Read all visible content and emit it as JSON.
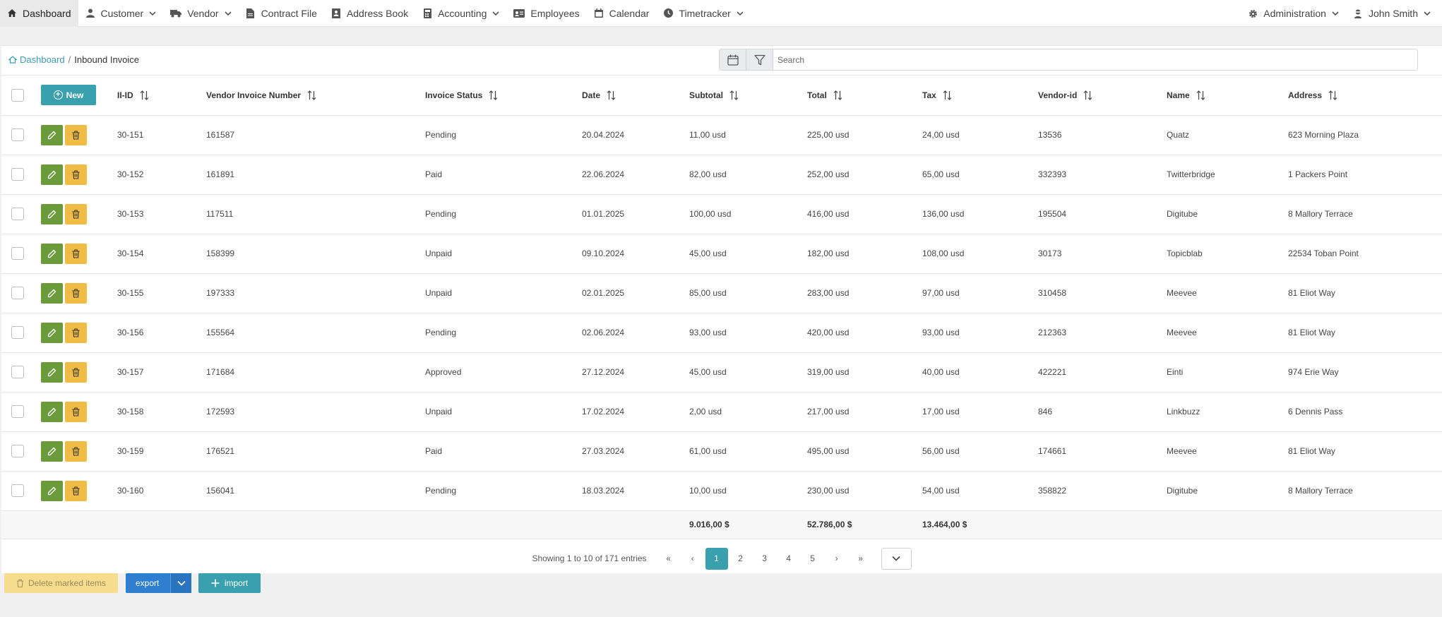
{
  "nav": {
    "items": [
      {
        "label": "Dashboard",
        "icon": "home-icon"
      },
      {
        "label": "Customer",
        "icon": "user-icon"
      },
      {
        "label": "Vendor",
        "icon": "truck-icon"
      },
      {
        "label": "Contract File",
        "icon": "file-icon"
      },
      {
        "label": "Address Book",
        "icon": "address-book-icon"
      },
      {
        "label": "Accounting",
        "icon": "calculator-icon"
      },
      {
        "label": "Employees",
        "icon": "id-card-icon"
      },
      {
        "label": "Calendar",
        "icon": "calendar-icon"
      },
      {
        "label": "Timetracker",
        "icon": "clock-icon"
      }
    ],
    "admin_label": "Administration",
    "user_label": "John Smith"
  },
  "breadcrumb": {
    "root": "Dashboard",
    "separator": "/",
    "current": "Inbound Invoice"
  },
  "search": {
    "placeholder": "Search"
  },
  "table": {
    "new_label": "New",
    "headers": {
      "id": "II-ID",
      "vin": "Vendor Invoice Number",
      "status": "Invoice Status",
      "date": "Date",
      "subtotal": "Subtotal",
      "total": "Total",
      "tax": "Tax",
      "vendor_id": "Vendor-id",
      "name": "Name",
      "address": "Address"
    },
    "rows": [
      {
        "id": "30-151",
        "vin": "161587",
        "status": "Pending",
        "date": "20.04.2024",
        "subtotal": "11,00 usd",
        "total": "225,00 usd",
        "tax": "24,00 usd",
        "vendor_id": "13536",
        "name": "Quatz",
        "address": "623 Morning Plaza"
      },
      {
        "id": "30-152",
        "vin": "161891",
        "status": "Paid",
        "date": "22.06.2024",
        "subtotal": "82,00 usd",
        "total": "252,00 usd",
        "tax": "65,00 usd",
        "vendor_id": "332393",
        "name": "Twitterbridge",
        "address": "1 Packers Point"
      },
      {
        "id": "30-153",
        "vin": "117511",
        "status": "Pending",
        "date": "01.01.2025",
        "subtotal": "100,00 usd",
        "total": "416,00 usd",
        "tax": "136,00 usd",
        "vendor_id": "195504",
        "name": "Digitube",
        "address": "8 Mallory Terrace"
      },
      {
        "id": "30-154",
        "vin": "158399",
        "status": "Unpaid",
        "date": "09.10.2024",
        "subtotal": "45,00 usd",
        "total": "182,00 usd",
        "tax": "108,00 usd",
        "vendor_id": "30173",
        "name": "Topicblab",
        "address": "22534 Toban Point"
      },
      {
        "id": "30-155",
        "vin": "197333",
        "status": "Unpaid",
        "date": "02.01.2025",
        "subtotal": "85,00 usd",
        "total": "283,00 usd",
        "tax": "97,00 usd",
        "vendor_id": "310458",
        "name": "Meevee",
        "address": "81 Eliot Way"
      },
      {
        "id": "30-156",
        "vin": "155564",
        "status": "Pending",
        "date": "02.06.2024",
        "subtotal": "93,00 usd",
        "total": "420,00 usd",
        "tax": "93,00 usd",
        "vendor_id": "212363",
        "name": "Meevee",
        "address": "81 Eliot Way"
      },
      {
        "id": "30-157",
        "vin": "171684",
        "status": "Approved",
        "date": "27.12.2024",
        "subtotal": "45,00 usd",
        "total": "319,00 usd",
        "tax": "40,00 usd",
        "vendor_id": "422221",
        "name": "Einti",
        "address": "974 Erie Way"
      },
      {
        "id": "30-158",
        "vin": "172593",
        "status": "Unpaid",
        "date": "17.02.2024",
        "subtotal": "2,00 usd",
        "total": "217,00 usd",
        "tax": "17,00 usd",
        "vendor_id": "846",
        "name": "Linkbuzz",
        "address": "6 Dennis Pass"
      },
      {
        "id": "30-159",
        "vin": "176521",
        "status": "Paid",
        "date": "27.03.2024",
        "subtotal": "61,00 usd",
        "total": "495,00 usd",
        "tax": "56,00 usd",
        "vendor_id": "174661",
        "name": "Meevee",
        "address": "81 Eliot Way"
      },
      {
        "id": "30-160",
        "vin": "156041",
        "status": "Pending",
        "date": "18.03.2024",
        "subtotal": "10,00 usd",
        "total": "230,00 usd",
        "tax": "54,00 usd",
        "vendor_id": "358822",
        "name": "Digitube",
        "address": "8 Mallory Terrace"
      }
    ],
    "totals": {
      "subtotal": "9.016,00 $",
      "total": "52.786,00 $",
      "tax": "13.464,00 $"
    }
  },
  "pagination": {
    "info": "Showing 1 to 10 of 171 entries",
    "first": "«",
    "prev": "‹",
    "pages": [
      "1",
      "2",
      "3",
      "4",
      "5"
    ],
    "current": "1",
    "next": "›",
    "last": "»"
  },
  "bottom": {
    "delete_label": "Delete marked items",
    "export_label": "export",
    "import_label": "import"
  },
  "colors": {
    "teal": "#3aa0ad",
    "edit_green": "#6a9a3a",
    "delete_yellow": "#f0bc45",
    "export_blue": "#2f7fd0",
    "delete_marked_bg": "#f6dc8e"
  }
}
